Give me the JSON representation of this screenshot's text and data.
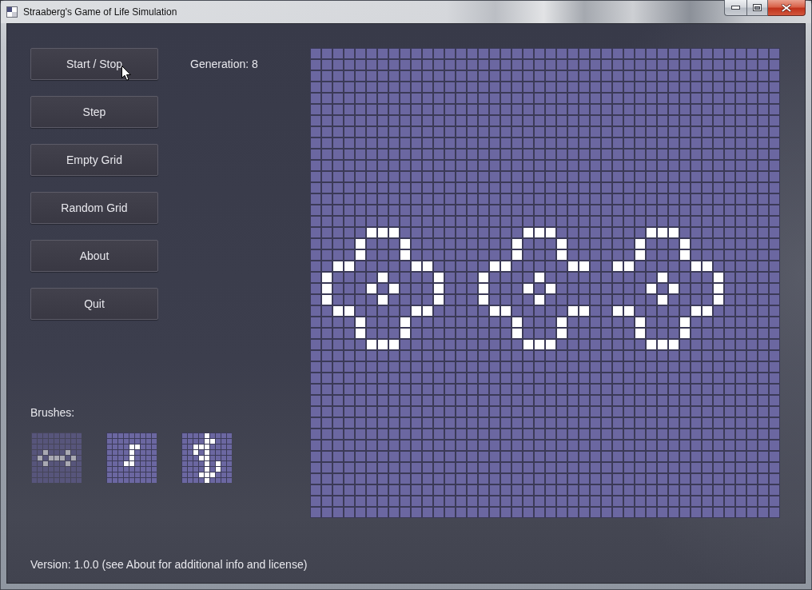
{
  "window": {
    "title": "Straaberg's Game of Life Simulation"
  },
  "buttons": [
    "Start / Stop",
    "Step",
    "Empty Grid",
    "Random Grid",
    "About",
    "Quit"
  ],
  "generation": "Generation: 8",
  "grid": {
    "cells": [
      [
        false,
        false,
        false,
        false,
        false,
        false,
        false,
        false,
        false,
        false,
        false,
        false,
        false,
        false,
        false,
        false,
        false,
        false,
        false,
        false,
        false,
        false,
        false,
        false,
        false,
        false,
        false,
        false,
        false,
        false,
        false,
        false,
        false,
        false,
        false,
        false,
        false,
        false,
        false,
        false,
        false,
        false
      ],
      [
        false,
        false,
        false,
        false,
        false,
        false,
        false,
        false,
        false,
        false,
        false,
        false,
        false,
        false,
        false,
        false,
        false,
        false,
        false,
        false,
        false,
        false,
        false,
        false,
        false,
        false,
        false,
        false,
        false,
        false,
        false,
        false,
        false,
        false,
        false,
        false,
        false,
        false,
        false,
        false,
        false,
        false
      ],
      [
        false,
        false,
        false,
        false,
        false,
        false,
        false,
        false,
        false,
        false,
        false,
        false,
        false,
        false,
        false,
        false,
        false,
        false,
        false,
        false,
        false,
        false,
        false,
        false,
        false,
        false,
        false,
        false,
        false,
        false,
        false,
        false,
        false,
        false,
        false,
        false,
        false,
        false,
        false,
        false,
        false,
        false
      ],
      [
        false,
        false,
        false,
        false,
        false,
        false,
        false,
        false,
        false,
        false,
        false,
        false,
        false,
        false,
        false,
        false,
        false,
        false,
        false,
        false,
        false,
        false,
        false,
        false,
        false,
        false,
        false,
        false,
        false,
        false,
        false,
        false,
        false,
        false,
        false,
        false,
        false,
        false,
        false,
        false,
        false,
        false
      ],
      [
        false,
        false,
        false,
        false,
        false,
        false,
        false,
        false,
        false,
        false,
        false,
        false,
        false,
        false,
        false,
        false,
        false,
        false,
        false,
        false,
        false,
        false,
        false,
        false,
        false,
        false,
        false,
        false,
        false,
        false,
        false,
        false,
        false,
        false,
        false,
        false,
        false,
        false,
        false,
        false,
        false,
        false
      ],
      [
        false,
        false,
        false,
        false,
        false,
        false,
        false,
        false,
        false,
        false,
        false,
        false,
        false,
        false,
        false,
        false,
        false,
        false,
        false,
        false,
        false,
        false,
        false,
        false,
        false,
        false,
        false,
        false,
        false,
        false,
        false,
        false,
        false,
        false,
        false,
        false,
        false,
        false,
        false,
        false,
        false,
        false
      ],
      [
        false,
        false,
        false,
        false,
        false,
        false,
        false,
        false,
        false,
        false,
        false,
        false,
        false,
        false,
        false,
        false,
        false,
        false,
        false,
        false,
        false,
        false,
        false,
        false,
        false,
        false,
        false,
        false,
        false,
        false,
        false,
        false,
        false,
        false,
        false,
        false,
        false,
        false,
        false,
        false,
        false,
        false
      ],
      [
        false,
        false,
        false,
        false,
        false,
        false,
        false,
        false,
        false,
        false,
        false,
        false,
        false,
        false,
        false,
        false,
        false,
        false,
        false,
        false,
        false,
        false,
        false,
        false,
        false,
        false,
        false,
        false,
        false,
        false,
        false,
        false,
        false,
        false,
        false,
        false,
        false,
        false,
        false,
        false,
        false,
        false
      ],
      [
        false,
        false,
        false,
        false,
        false,
        false,
        false,
        false,
        false,
        false,
        false,
        false,
        false,
        false,
        false,
        false,
        false,
        false,
        false,
        false,
        false,
        false,
        false,
        false,
        false,
        false,
        false,
        false,
        false,
        false,
        false,
        false,
        false,
        false,
        false,
        false,
        false,
        false,
        false,
        false,
        false,
        false
      ],
      [
        false,
        false,
        false,
        false,
        false,
        false,
        false,
        false,
        false,
        false,
        false,
        false,
        false,
        false,
        false,
        false,
        false,
        false,
        false,
        false,
        false,
        false,
        false,
        false,
        false,
        false,
        false,
        false,
        false,
        false,
        false,
        false,
        false,
        false,
        false,
        false,
        false,
        false,
        false,
        false,
        false,
        false
      ],
      [
        false,
        false,
        false,
        false,
        false,
        false,
        false,
        false,
        false,
        false,
        false,
        false,
        false,
        false,
        false,
        false,
        false,
        false,
        false,
        false,
        false,
        false,
        false,
        false,
        false,
        false,
        false,
        false,
        false,
        false,
        false,
        false,
        false,
        false,
        false,
        false,
        false,
        false,
        false,
        false,
        false,
        false
      ],
      [
        false,
        false,
        false,
        false,
        false,
        false,
        false,
        false,
        false,
        false,
        false,
        false,
        false,
        false,
        false,
        false,
        false,
        false,
        false,
        false,
        false,
        false,
        false,
        false,
        false,
        false,
        false,
        false,
        false,
        false,
        false,
        false,
        false,
        false,
        false,
        false,
        false,
        false,
        false,
        false,
        false,
        false
      ],
      [
        false,
        false,
        false,
        false,
        false,
        false,
        false,
        false,
        false,
        false,
        false,
        false,
        false,
        false,
        false,
        false,
        false,
        false,
        false,
        false,
        false,
        false,
        false,
        false,
        false,
        false,
        false,
        false,
        false,
        false,
        false,
        false,
        false,
        false,
        false,
        false,
        false,
        false,
        false,
        false,
        false,
        false
      ],
      [
        false,
        false,
        false,
        false,
        false,
        false,
        false,
        false,
        false,
        false,
        false,
        false,
        false,
        false,
        false,
        false,
        false,
        false,
        false,
        false,
        false,
        false,
        false,
        false,
        false,
        false,
        false,
        false,
        false,
        false,
        false,
        false,
        false,
        false,
        false,
        false,
        false,
        false,
        false,
        false,
        false,
        false
      ],
      [
        false,
        false,
        false,
        false,
        false,
        false,
        false,
        false,
        false,
        false,
        false,
        false,
        false,
        false,
        false,
        false,
        false,
        false,
        false,
        false,
        false,
        false,
        false,
        false,
        false,
        false,
        false,
        false,
        false,
        false,
        false,
        false,
        false,
        false,
        false,
        false,
        false,
        false,
        false,
        false,
        false,
        false
      ],
      [
        false,
        false,
        false,
        false,
        false,
        false,
        false,
        false,
        false,
        false,
        false,
        false,
        false,
        false,
        false,
        false,
        false,
        false,
        false,
        false,
        false,
        false,
        false,
        false,
        false,
        false,
        false,
        false,
        false,
        false,
        false,
        false,
        false,
        false,
        false,
        false,
        false,
        false,
        false,
        false,
        false,
        false
      ],
      [
        false,
        false,
        false,
        false,
        false,
        true,
        true,
        true,
        false,
        false,
        false,
        false,
        false,
        false,
        false,
        false,
        false,
        false,
        false,
        true,
        true,
        true,
        false,
        false,
        false,
        false,
        false,
        false,
        false,
        false,
        true,
        true,
        true,
        false,
        false,
        false,
        false,
        false,
        false,
        false,
        false,
        false
      ],
      [
        false,
        false,
        false,
        false,
        true,
        false,
        false,
        false,
        true,
        false,
        false,
        false,
        false,
        false,
        false,
        false,
        false,
        false,
        true,
        false,
        false,
        false,
        true,
        false,
        false,
        false,
        false,
        false,
        false,
        true,
        false,
        false,
        false,
        true,
        false,
        false,
        false,
        false,
        false,
        false,
        false,
        false
      ],
      [
        false,
        false,
        false,
        false,
        true,
        false,
        false,
        false,
        true,
        false,
        false,
        false,
        false,
        false,
        false,
        false,
        false,
        false,
        true,
        false,
        false,
        false,
        true,
        false,
        false,
        false,
        false,
        false,
        false,
        true,
        false,
        false,
        false,
        true,
        false,
        false,
        false,
        false,
        false,
        false,
        false,
        false
      ],
      [
        false,
        false,
        true,
        true,
        false,
        false,
        false,
        false,
        false,
        true,
        true,
        false,
        false,
        false,
        false,
        false,
        true,
        true,
        false,
        false,
        false,
        false,
        false,
        true,
        true,
        false,
        false,
        true,
        true,
        false,
        false,
        false,
        false,
        false,
        true,
        true,
        false,
        false,
        false,
        false,
        false,
        false
      ],
      [
        false,
        true,
        false,
        false,
        false,
        false,
        true,
        false,
        false,
        false,
        false,
        true,
        false,
        false,
        false,
        true,
        false,
        false,
        false,
        false,
        true,
        false,
        false,
        false,
        false,
        false,
        false,
        false,
        false,
        false,
        false,
        true,
        false,
        false,
        false,
        false,
        true,
        false,
        false,
        false,
        false,
        false
      ],
      [
        false,
        true,
        false,
        false,
        false,
        true,
        false,
        true,
        false,
        false,
        false,
        true,
        false,
        false,
        false,
        true,
        false,
        false,
        false,
        true,
        false,
        true,
        false,
        false,
        false,
        false,
        false,
        false,
        false,
        false,
        true,
        false,
        true,
        false,
        false,
        false,
        true,
        false,
        false,
        false,
        false,
        false
      ],
      [
        false,
        true,
        false,
        false,
        false,
        false,
        true,
        false,
        false,
        false,
        false,
        true,
        false,
        false,
        false,
        true,
        false,
        false,
        false,
        false,
        true,
        false,
        false,
        false,
        false,
        false,
        false,
        false,
        false,
        false,
        false,
        true,
        false,
        false,
        false,
        false,
        true,
        false,
        false,
        false,
        false,
        false
      ],
      [
        false,
        false,
        true,
        true,
        false,
        false,
        false,
        false,
        false,
        true,
        true,
        false,
        false,
        false,
        false,
        false,
        true,
        true,
        false,
        false,
        false,
        false,
        false,
        true,
        true,
        false,
        false,
        true,
        true,
        false,
        false,
        false,
        false,
        false,
        true,
        true,
        false,
        false,
        false,
        false,
        false,
        false
      ],
      [
        false,
        false,
        false,
        false,
        true,
        false,
        false,
        false,
        true,
        false,
        false,
        false,
        false,
        false,
        false,
        false,
        false,
        false,
        true,
        false,
        false,
        false,
        true,
        false,
        false,
        false,
        false,
        false,
        false,
        true,
        false,
        false,
        false,
        true,
        false,
        false,
        false,
        false,
        false,
        false,
        false,
        false
      ],
      [
        false,
        false,
        false,
        false,
        true,
        false,
        false,
        false,
        true,
        false,
        false,
        false,
        false,
        false,
        false,
        false,
        false,
        false,
        true,
        false,
        false,
        false,
        true,
        false,
        false,
        false,
        false,
        false,
        false,
        true,
        false,
        false,
        false,
        true,
        false,
        false,
        false,
        false,
        false,
        false,
        false,
        false
      ],
      [
        false,
        false,
        false,
        false,
        false,
        true,
        true,
        true,
        false,
        false,
        false,
        false,
        false,
        false,
        false,
        false,
        false,
        false,
        false,
        true,
        true,
        true,
        false,
        false,
        false,
        false,
        false,
        false,
        false,
        false,
        true,
        true,
        true,
        false,
        false,
        false,
        false,
        false,
        false,
        false,
        false,
        false
      ],
      [
        false,
        false,
        false,
        false,
        false,
        false,
        false,
        false,
        false,
        false,
        false,
        false,
        false,
        false,
        false,
        false,
        false,
        false,
        false,
        false,
        false,
        false,
        false,
        false,
        false,
        false,
        false,
        false,
        false,
        false,
        false,
        false,
        false,
        false,
        false,
        false,
        false,
        false,
        false,
        false,
        false,
        false
      ],
      [
        false,
        false,
        false,
        false,
        false,
        false,
        false,
        false,
        false,
        false,
        false,
        false,
        false,
        false,
        false,
        false,
        false,
        false,
        false,
        false,
        false,
        false,
        false,
        false,
        false,
        false,
        false,
        false,
        false,
        false,
        false,
        false,
        false,
        false,
        false,
        false,
        false,
        false,
        false,
        false,
        false,
        false
      ],
      [
        false,
        false,
        false,
        false,
        false,
        false,
        false,
        false,
        false,
        false,
        false,
        false,
        false,
        false,
        false,
        false,
        false,
        false,
        false,
        false,
        false,
        false,
        false,
        false,
        false,
        false,
        false,
        false,
        false,
        false,
        false,
        false,
        false,
        false,
        false,
        false,
        false,
        false,
        false,
        false,
        false,
        false
      ],
      [
        false,
        false,
        false,
        false,
        false,
        false,
        false,
        false,
        false,
        false,
        false,
        false,
        false,
        false,
        false,
        false,
        false,
        false,
        false,
        false,
        false,
        false,
        false,
        false,
        false,
        false,
        false,
        false,
        false,
        false,
        false,
        false,
        false,
        false,
        false,
        false,
        false,
        false,
        false,
        false,
        false,
        false
      ],
      [
        false,
        false,
        false,
        false,
        false,
        false,
        false,
        false,
        false,
        false,
        false,
        false,
        false,
        false,
        false,
        false,
        false,
        false,
        false,
        false,
        false,
        false,
        false,
        false,
        false,
        false,
        false,
        false,
        false,
        false,
        false,
        false,
        false,
        false,
        false,
        false,
        false,
        false,
        false,
        false,
        false,
        false
      ],
      [
        false,
        false,
        false,
        false,
        false,
        false,
        false,
        false,
        false,
        false,
        false,
        false,
        false,
        false,
        false,
        false,
        false,
        false,
        false,
        false,
        false,
        false,
        false,
        false,
        false,
        false,
        false,
        false,
        false,
        false,
        false,
        false,
        false,
        false,
        false,
        false,
        false,
        false,
        false,
        false,
        false,
        false
      ],
      [
        false,
        false,
        false,
        false,
        false,
        false,
        false,
        false,
        false,
        false,
        false,
        false,
        false,
        false,
        false,
        false,
        false,
        false,
        false,
        false,
        false,
        false,
        false,
        false,
        false,
        false,
        false,
        false,
        false,
        false,
        false,
        false,
        false,
        false,
        false,
        false,
        false,
        false,
        false,
        false,
        false,
        false
      ],
      [
        false,
        false,
        false,
        false,
        false,
        false,
        false,
        false,
        false,
        false,
        false,
        false,
        false,
        false,
        false,
        false,
        false,
        false,
        false,
        false,
        false,
        false,
        false,
        false,
        false,
        false,
        false,
        false,
        false,
        false,
        false,
        false,
        false,
        false,
        false,
        false,
        false,
        false,
        false,
        false,
        false,
        false
      ],
      [
        false,
        false,
        false,
        false,
        false,
        false,
        false,
        false,
        false,
        false,
        false,
        false,
        false,
        false,
        false,
        false,
        false,
        false,
        false,
        false,
        false,
        false,
        false,
        false,
        false,
        false,
        false,
        false,
        false,
        false,
        false,
        false,
        false,
        false,
        false,
        false,
        false,
        false,
        false,
        false,
        false,
        false
      ],
      [
        false,
        false,
        false,
        false,
        false,
        false,
        false,
        false,
        false,
        false,
        false,
        false,
        false,
        false,
        false,
        false,
        false,
        false,
        false,
        false,
        false,
        false,
        false,
        false,
        false,
        false,
        false,
        false,
        false,
        false,
        false,
        false,
        false,
        false,
        false,
        false,
        false,
        false,
        false,
        false,
        false,
        false
      ],
      [
        false,
        false,
        false,
        false,
        false,
        false,
        false,
        false,
        false,
        false,
        false,
        false,
        false,
        false,
        false,
        false,
        false,
        false,
        false,
        false,
        false,
        false,
        false,
        false,
        false,
        false,
        false,
        false,
        false,
        false,
        false,
        false,
        false,
        false,
        false,
        false,
        false,
        false,
        false,
        false,
        false,
        false
      ],
      [
        false,
        false,
        false,
        false,
        false,
        false,
        false,
        false,
        false,
        false,
        false,
        false,
        false,
        false,
        false,
        false,
        false,
        false,
        false,
        false,
        false,
        false,
        false,
        false,
        false,
        false,
        false,
        false,
        false,
        false,
        false,
        false,
        false,
        false,
        false,
        false,
        false,
        false,
        false,
        false,
        false,
        false
      ],
      [
        false,
        false,
        false,
        false,
        false,
        false,
        false,
        false,
        false,
        false,
        false,
        false,
        false,
        false,
        false,
        false,
        false,
        false,
        false,
        false,
        false,
        false,
        false,
        false,
        false,
        false,
        false,
        false,
        false,
        false,
        false,
        false,
        false,
        false,
        false,
        false,
        false,
        false,
        false,
        false,
        false,
        false
      ],
      [
        false,
        false,
        false,
        false,
        false,
        false,
        false,
        false,
        false,
        false,
        false,
        false,
        false,
        false,
        false,
        false,
        false,
        false,
        false,
        false,
        false,
        false,
        false,
        false,
        false,
        false,
        false,
        false,
        false,
        false,
        false,
        false,
        false,
        false,
        false,
        false,
        false,
        false,
        false,
        false,
        false,
        false
      ],
      [
        false,
        false,
        false,
        false,
        false,
        false,
        false,
        false,
        false,
        false,
        false,
        false,
        false,
        false,
        false,
        false,
        false,
        false,
        false,
        false,
        false,
        false,
        false,
        false,
        false,
        false,
        false,
        false,
        false,
        false,
        false,
        false,
        false,
        false,
        false,
        false,
        false,
        false,
        false,
        false,
        false,
        false
      ]
    ]
  },
  "brushes": {
    "label": "Brushes:",
    "items": [
      {
        "selected": true,
        "cells": [
          [
            false,
            false,
            false,
            false,
            false,
            false,
            false,
            false,
            false
          ],
          [
            false,
            false,
            false,
            false,
            false,
            false,
            false,
            false,
            false
          ],
          [
            false,
            false,
            false,
            false,
            false,
            false,
            false,
            false,
            false
          ],
          [
            false,
            false,
            true,
            false,
            false,
            false,
            true,
            false,
            false
          ],
          [
            false,
            true,
            false,
            true,
            true,
            true,
            false,
            true,
            false
          ],
          [
            false,
            false,
            true,
            false,
            false,
            false,
            true,
            false,
            false
          ],
          [
            false,
            false,
            false,
            false,
            false,
            false,
            false,
            false,
            false
          ],
          [
            false,
            false,
            false,
            false,
            false,
            false,
            false,
            false,
            false
          ],
          [
            false,
            false,
            false,
            false,
            false,
            false,
            false,
            false,
            false
          ]
        ]
      },
      {
        "selected": false,
        "cells": [
          [
            false,
            false,
            false,
            false,
            false,
            false,
            false,
            false,
            false
          ],
          [
            false,
            false,
            false,
            false,
            false,
            false,
            false,
            false,
            false
          ],
          [
            false,
            false,
            false,
            false,
            true,
            true,
            false,
            false,
            false
          ],
          [
            false,
            false,
            false,
            false,
            true,
            false,
            false,
            false,
            false
          ],
          [
            false,
            false,
            false,
            false,
            true,
            false,
            false,
            false,
            false
          ],
          [
            false,
            false,
            false,
            true,
            true,
            false,
            false,
            false,
            false
          ],
          [
            false,
            false,
            false,
            false,
            false,
            false,
            false,
            false,
            false
          ],
          [
            false,
            false,
            false,
            false,
            false,
            false,
            false,
            false,
            false
          ],
          [
            false,
            false,
            false,
            false,
            false,
            false,
            false,
            false,
            false
          ]
        ]
      },
      {
        "selected": false,
        "cells": [
          [
            false,
            false,
            false,
            false,
            true,
            false,
            false,
            false,
            false
          ],
          [
            false,
            false,
            false,
            false,
            true,
            true,
            false,
            false,
            false
          ],
          [
            false,
            false,
            true,
            true,
            true,
            false,
            false,
            false,
            false
          ],
          [
            false,
            false,
            true,
            false,
            true,
            false,
            false,
            false,
            false
          ],
          [
            false,
            false,
            false,
            true,
            true,
            false,
            false,
            false,
            false
          ],
          [
            false,
            false,
            false,
            false,
            true,
            false,
            true,
            false,
            false
          ],
          [
            false,
            false,
            false,
            false,
            true,
            false,
            true,
            false,
            false
          ],
          [
            false,
            false,
            false,
            true,
            true,
            true,
            false,
            false,
            false
          ],
          [
            false,
            false,
            false,
            false,
            true,
            false,
            false,
            false,
            false
          ]
        ]
      }
    ]
  },
  "status": "Version: 1.0.0 (see About for additional info and license)"
}
